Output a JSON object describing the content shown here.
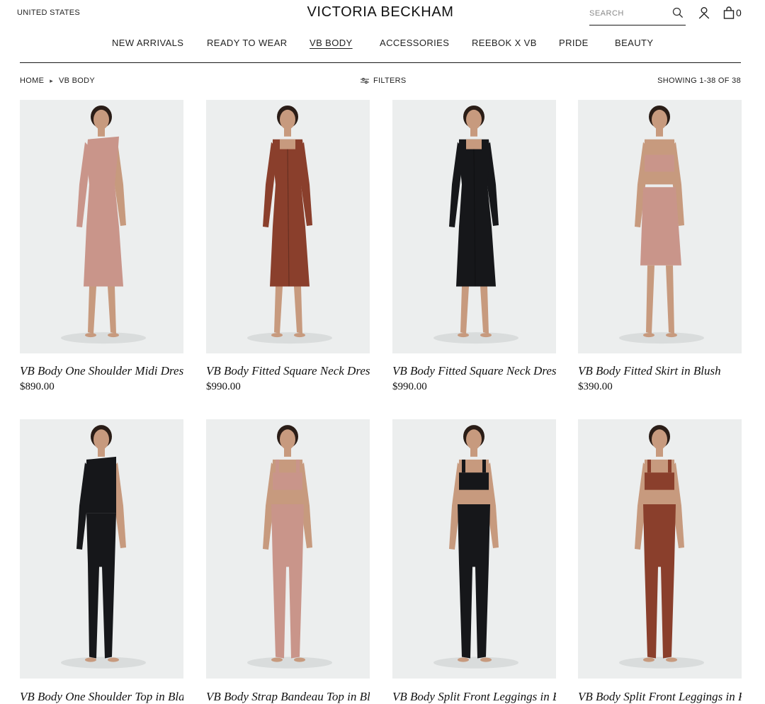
{
  "header": {
    "region": "UNITED STATES",
    "logo": "VICTORIA BECKHAM",
    "search_placeholder": "SEARCH",
    "bag_count": "0"
  },
  "nav": {
    "items": [
      {
        "label": "NEW ARRIVALS",
        "active": false
      },
      {
        "label": "READY TO WEAR",
        "active": false
      },
      {
        "label": "VB BODY",
        "active": true
      },
      {
        "label": "ACCESSORIES",
        "active": false
      },
      {
        "label": "REEBOK X VB",
        "active": false
      },
      {
        "label": "PRIDE",
        "active": false
      },
      {
        "label": "BEAUTY",
        "active": false
      }
    ]
  },
  "breadcrumb": {
    "home": "HOME",
    "current": "VB BODY"
  },
  "toolbar": {
    "filters_label": "FILTERS",
    "showing": "SHOWING 1-38 OF 38"
  },
  "colors": {
    "blush": "#c9958a",
    "rust": "#8a3f2c",
    "black": "#16171a",
    "backdrop": "#eceeee",
    "skin": "#c79a7e"
  },
  "products": [
    {
      "name": "VB Body One Shoulder Midi Dress in Blush",
      "price": "$890.00",
      "color": "blush",
      "style": "one-shoulder-dress"
    },
    {
      "name": "VB Body Fitted Square Neck Dress in Rust",
      "price": "$990.00",
      "color": "rust",
      "style": "square-neck-dress"
    },
    {
      "name": "VB Body Fitted Square Neck Dress in Black",
      "price": "$990.00",
      "color": "black",
      "style": "square-neck-dress"
    },
    {
      "name": "VB Body Fitted Skirt in Blush",
      "price": "$390.00",
      "color": "blush",
      "style": "bandeau-skirt"
    },
    {
      "name": "VB Body One Shoulder Top in Black",
      "price": "",
      "color": "black",
      "style": "one-shoulder-top-leggings"
    },
    {
      "name": "VB Body Strap Bandeau Top in Blush",
      "price": "",
      "color": "blush",
      "style": "bandeau-leggings"
    },
    {
      "name": "VB Body Split Front Leggings in Black",
      "price": "",
      "color": "black",
      "style": "bandeau-leggings"
    },
    {
      "name": "VB Body Split Front Leggings in Rust",
      "price": "",
      "color": "rust",
      "style": "bandeau-leggings"
    }
  ]
}
